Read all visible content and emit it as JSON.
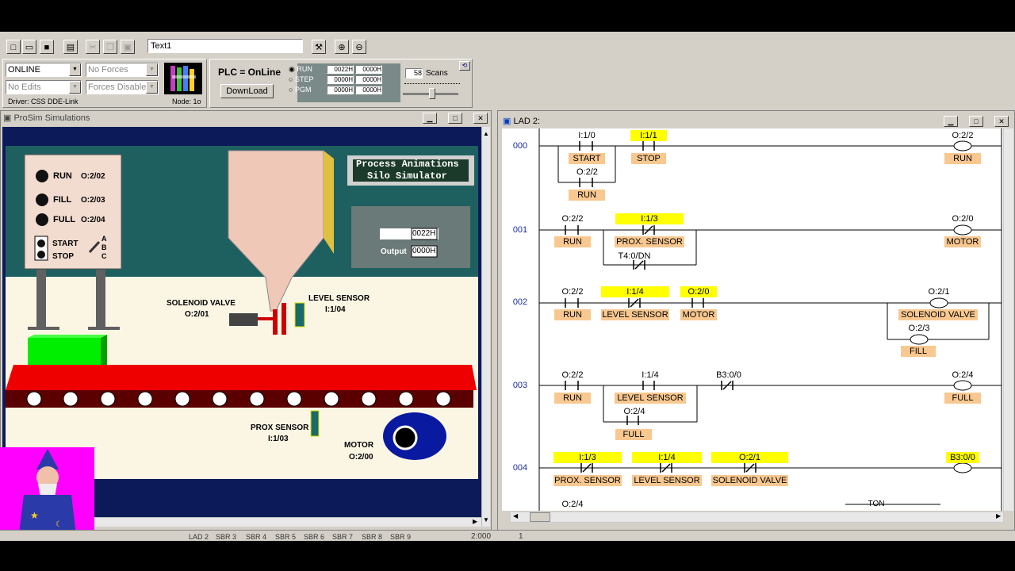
{
  "toolbar": {
    "text_field": "Text1"
  },
  "status_panel": {
    "mode": "ONLINE",
    "forces": "No Forces",
    "edits": "No Edits",
    "forces_state": "Forces Disabled",
    "driver": "Driver: CSS DDE-Link",
    "node": "Node: 1o"
  },
  "plc_panel": {
    "status": "PLC = OnLine",
    "download": "DownLoad",
    "modes": [
      "RUN",
      "STEP",
      "PGM"
    ],
    "values": [
      [
        "0022H",
        "0000H"
      ],
      [
        "0000H",
        "0000H"
      ],
      [
        "0000H",
        "0000H"
      ]
    ],
    "scan_count": "58",
    "scans_label": "Scans"
  },
  "sim_window": {
    "title": "ProSim Simulations",
    "anim_title1": "Process Animations",
    "anim_title2": "Silo Simulator",
    "panel": [
      {
        "label": "RUN",
        "addr": "O:2/02"
      },
      {
        "label": "FILL",
        "addr": "O:2/03"
      },
      {
        "label": "FULL",
        "addr": "O:2/04"
      }
    ],
    "start": "START",
    "stop": "STOP",
    "abc": [
      "A",
      "B",
      "C"
    ],
    "solenoid": "SOLENOID VALVE",
    "solenoid_addr": "O:2/01",
    "level": "LEVEL SENSOR",
    "level_addr": "I:1/04",
    "prox": "PROX SENSOR",
    "prox_addr": "I:1/03",
    "motor": "MOTOR",
    "motor_addr": "O:2/00",
    "input_label": "Input",
    "input_val": "0022H",
    "output_label": "Output",
    "output_val": "0000H"
  },
  "lad_window": {
    "title": "LAD 2:",
    "rungs": [
      "000",
      "001",
      "002",
      "003",
      "004"
    ],
    "tags": {
      "r0_start_addr": "I:1/0",
      "r0_start": "START",
      "r0_stop_addr": "I:1/1",
      "r0_stop": "STOP",
      "r0_run_addr": "O:2/2",
      "r0_run": "RUN",
      "r0_out_addr": "O:2/2",
      "r0_out": "RUN",
      "r1_run_addr": "O:2/2",
      "r1_run": "RUN",
      "r1_prox_addr": "I:1/3",
      "r1_prox": "PROX. SENSOR",
      "r1_timer": "T4:0/DN",
      "r1_out_addr": "O:2/0",
      "r1_out": "MOTOR",
      "r2_run_addr": "O:2/2",
      "r2_run": "RUN",
      "r2_level_addr": "I:1/4",
      "r2_level": "LEVEL SENSOR",
      "r2_motor_addr": "O:2/0",
      "r2_motor": "MOTOR",
      "r2_out1_addr": "O:2/1",
      "r2_out1": "SOLENOID VALVE",
      "r2_out2_addr": "O:2/3",
      "r2_out2": "FILL",
      "r3_run_addr": "O:2/2",
      "r3_run": "RUN",
      "r3_level_addr": "I:1/4",
      "r3_level": "LEVEL SENSOR",
      "r3_full_addr": "O:2/4",
      "r3_full": "FULL",
      "r3_b3_addr": "B3:0/0",
      "r3_out_addr": "O:2/4",
      "r3_out": "FULL",
      "r4_prox_addr": "I:1/3",
      "r4_prox": "PROX. SENSOR",
      "r4_level_addr": "I:1/4",
      "r4_level": "LEVEL SENSOR",
      "r4_sol_addr": "O:2/1",
      "r4_sol": "SOLENOID VALVE",
      "r4_out_addr": "B3:0/0",
      "r5_addr": "O:2/4",
      "r5_ton": "TON"
    }
  },
  "bottom": {
    "tabs": [
      "LAD 2",
      "SBR 3",
      "SBR 4",
      "SBR 5",
      "SBR 6",
      "SBR 7",
      "SBR 8",
      "SBR 9"
    ],
    "coord": "2:000",
    "page": "1"
  },
  "colors": {
    "desc": "#f8c890",
    "highlight": "#ffff00",
    "rung_number": "#1c2da0"
  }
}
